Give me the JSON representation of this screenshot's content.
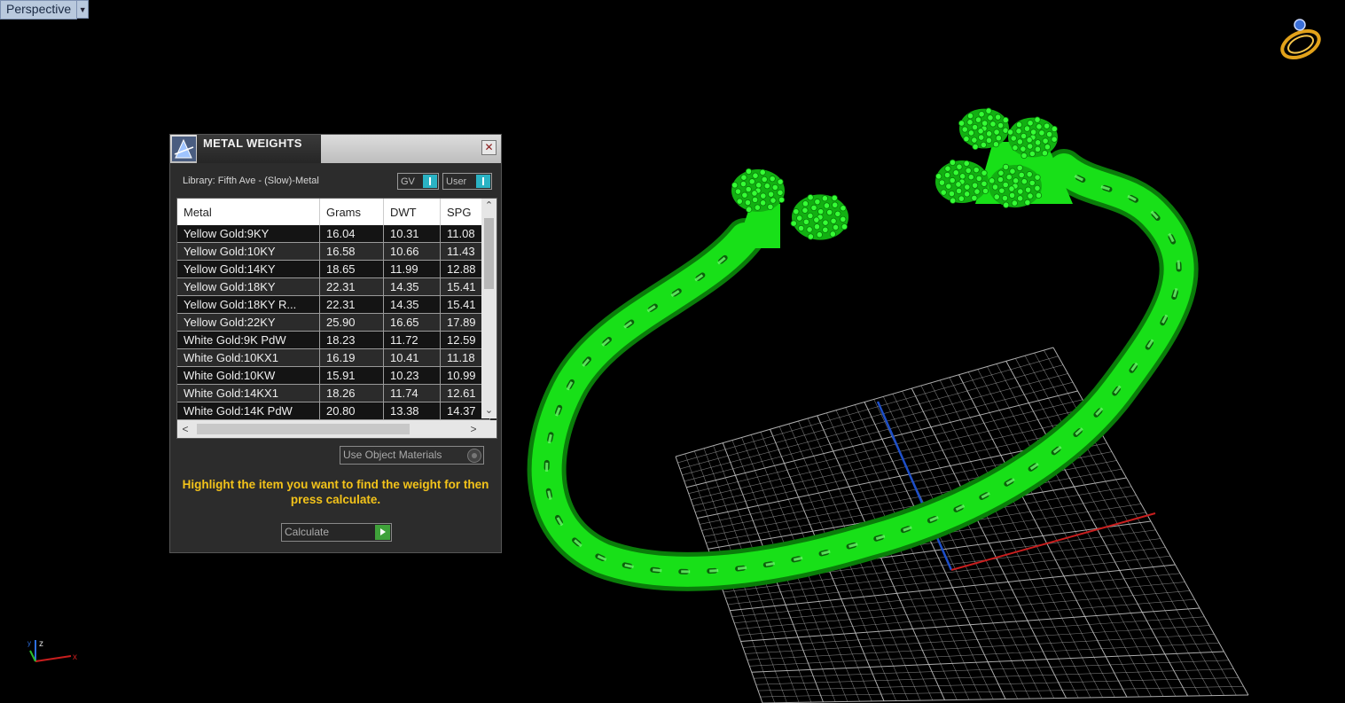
{
  "viewport": {
    "label": "Perspective",
    "background": "#000000",
    "model_color": "#18e018",
    "grid_color": "#bfbfbf",
    "x_axis_color": "#c81e1e",
    "y_axis_color": "#1e4fc8",
    "gizmo": {
      "z": "z",
      "x": "x",
      "y": "y"
    }
  },
  "dialog": {
    "title": "METAL WEIGHTS",
    "close_icon": "close-icon",
    "library_label": "Library: Fifth Ave - (Slow)-Metal",
    "toggle_gv": "GV",
    "toggle_user": "User",
    "table": {
      "headers": [
        "Metal",
        "Grams",
        "DWT",
        "SPG"
      ],
      "rows": [
        [
          "Yellow Gold:9KY",
          "16.04",
          "10.31",
          "11.08"
        ],
        [
          "Yellow Gold:10KY",
          "16.58",
          "10.66",
          "11.43"
        ],
        [
          "Yellow Gold:14KY",
          "18.65",
          "11.99",
          "12.88"
        ],
        [
          "Yellow Gold:18KY",
          "22.31",
          "14.35",
          "15.41"
        ],
        [
          "Yellow Gold:18KY R...",
          "22.31",
          "14.35",
          "15.41"
        ],
        [
          "Yellow Gold:22KY",
          "25.90",
          "16.65",
          "17.89"
        ],
        [
          "White Gold:9K PdW",
          "18.23",
          "11.72",
          "12.59"
        ],
        [
          "White Gold:10KX1",
          "16.19",
          "10.41",
          "11.18"
        ],
        [
          "White Gold:10KW",
          "15.91",
          "10.23",
          "10.99"
        ],
        [
          "White Gold:14KX1",
          "18.26",
          "11.74",
          "12.61"
        ],
        [
          "White Gold:14K PdW",
          "20.80",
          "13.38",
          "14.37"
        ]
      ]
    },
    "use_object_materials": "Use Object Materials",
    "hint": "Highlight the item you want to find the weight for then press calculate.",
    "calculate_label": "Calculate",
    "hint_color": "#f3c31a"
  }
}
